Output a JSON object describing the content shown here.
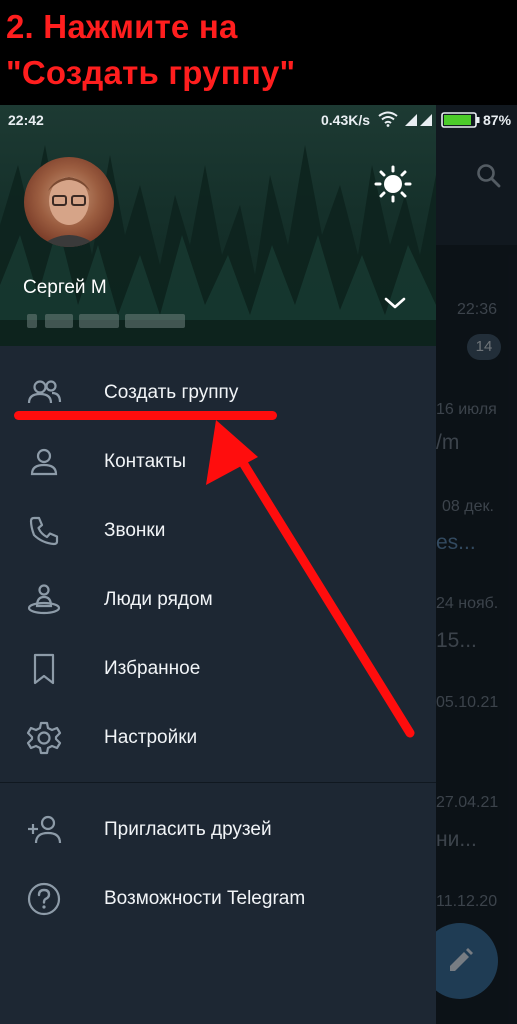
{
  "caption": {
    "line1": "2. Нажмите на",
    "line2": "\"Создать группу\""
  },
  "status_bar": {
    "time": "22:42",
    "speed": "0.43K/s",
    "battery": "87%"
  },
  "profile": {
    "name": "Сергей М"
  },
  "menu": {
    "items": [
      {
        "label": "Создать группу",
        "icon": "group-icon"
      },
      {
        "label": "Контакты",
        "icon": "person-icon"
      },
      {
        "label": "Звонки",
        "icon": "phone-icon"
      },
      {
        "label": "Люди рядом",
        "icon": "people-nearby-icon"
      },
      {
        "label": "Избранное",
        "icon": "bookmark-icon"
      },
      {
        "label": "Настройки",
        "icon": "gear-icon"
      }
    ],
    "extra": [
      {
        "label": "Пригласить друзей",
        "icon": "add-person-icon"
      },
      {
        "label": "Возможности Telegram",
        "icon": "question-icon"
      }
    ]
  },
  "background_chats": {
    "times": [
      "22:36",
      "16 июля",
      "08 дек.",
      "24 нояб.",
      "05.10.21",
      "27.04.21",
      "11.12.20"
    ],
    "snippets": [
      "/m",
      "es...",
      "15...",
      "ни..."
    ],
    "badge": "14"
  },
  "colors": {
    "annotation": "#ff0d0d",
    "drawer_bg": "#1d2733",
    "accent": "#3a6d99"
  }
}
